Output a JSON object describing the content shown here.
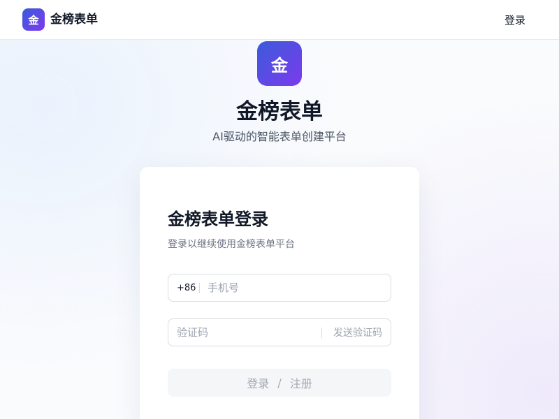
{
  "header": {
    "logo_char": "金",
    "brand_name": "金榜表单",
    "login_link": "登录"
  },
  "hero": {
    "logo_char": "金",
    "title": "金榜表单",
    "subtitle": "AI驱动的智能表单创建平台"
  },
  "login_card": {
    "title": "金榜表单登录",
    "subtitle": "登录以继续使用金榜表单平台",
    "phone": {
      "prefix": "+86",
      "value": "",
      "placeholder": "手机号"
    },
    "code": {
      "value": "",
      "placeholder": "验证码",
      "send_label": "发送验证码"
    },
    "submit": {
      "login_label": "登录",
      "separator": "/",
      "register_label": "注册"
    }
  },
  "colors": {
    "brand_gradient_start": "#3b5bdb",
    "brand_gradient_end": "#7c3aed",
    "disabled_text": "#a3a8b1",
    "disabled_bg": "#f5f6f8"
  }
}
